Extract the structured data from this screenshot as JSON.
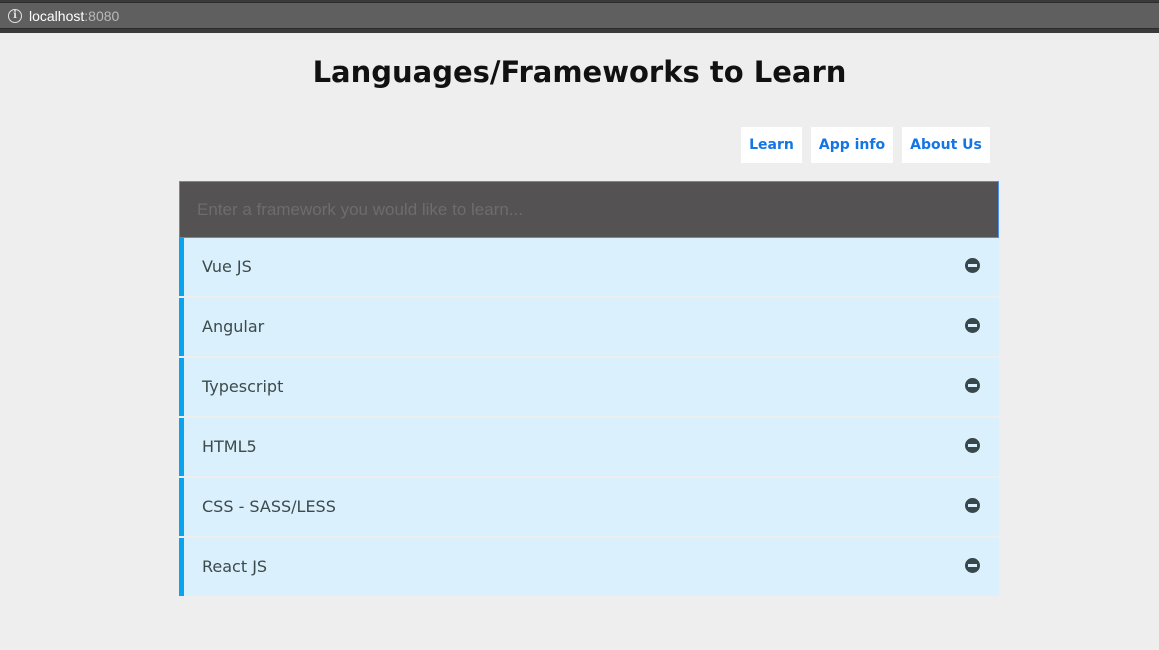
{
  "browser": {
    "url_host": "localhost",
    "url_port": ":8080"
  },
  "header": {
    "title": "Languages/Frameworks to Learn"
  },
  "nav": {
    "items": [
      {
        "label": "Learn"
      },
      {
        "label": "App info"
      },
      {
        "label": "About Us"
      }
    ]
  },
  "input": {
    "value": "",
    "placeholder": "Enter a framework you would like to learn..."
  },
  "list": {
    "items": [
      {
        "label": "Vue JS",
        "icon": "remove-circle-icon"
      },
      {
        "label": "Angular",
        "icon": "remove-circle-icon"
      },
      {
        "label": "Typescript",
        "icon": "remove-circle-icon"
      },
      {
        "label": "HTML5",
        "icon": "remove-circle-icon"
      },
      {
        "label": "CSS - SASS/LESS",
        "icon": "remove-circle-icon"
      },
      {
        "label": "React JS",
        "icon": "remove-circle-icon"
      }
    ]
  },
  "colors": {
    "page_background": "#eeeeee",
    "accent_link": "#1476e4",
    "list_item_background": "#daf0fd",
    "list_item_border": "#0aa3ee",
    "input_background": "#545252"
  }
}
